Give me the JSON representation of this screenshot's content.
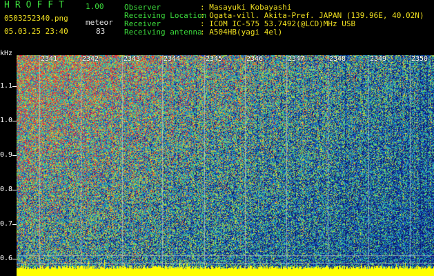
{
  "app": {
    "brand": "HROFFT",
    "version": "1.00",
    "file": "0503252340.png",
    "datetime": "05.03.25 23:40",
    "mode": "meteor",
    "count": "83"
  },
  "info": {
    "rows": [
      {
        "label": "Observer",
        "value": ": Masayuki Kobayashi"
      },
      {
        "label": "Receiving Location",
        "value": ": Ogata-vill. Akita-Pref. JAPAN (139.96E, 40.02N)"
      },
      {
        "label": "Receiver",
        "value": ": ICOM IC-575 53.7492(@LCD)MHz USB"
      },
      {
        "label": "Receiving antenna",
        "value": ": A504HB(yagi 4el)"
      }
    ]
  },
  "axis": {
    "unit": "kHz",
    "y_ticks": [
      "1.1",
      "1.0",
      "0.9",
      "0.8",
      "0.7",
      "0.6"
    ],
    "time_ticks": [
      "2341",
      "2342",
      "2343",
      "2344",
      "2345",
      "2346",
      "2347",
      "2348",
      "2349",
      "2350"
    ]
  },
  "colors": {
    "bg": "#000000",
    "label_green": "#3cdc3c",
    "value_yellow": "#f0e020",
    "text_white": "#e8e8e8",
    "noise_floor": "#ffff00"
  },
  "chart_data": {
    "type": "heatmap",
    "ylabel": "kHz",
    "y_ticks": [
      1.1,
      1.0,
      0.9,
      0.8,
      0.7,
      0.6
    ],
    "x_ticks": [
      "2341",
      "2342",
      "2343",
      "2344",
      "2345",
      "2346",
      "2347",
      "2348",
      "2349",
      "2350"
    ],
    "grid": true
  }
}
